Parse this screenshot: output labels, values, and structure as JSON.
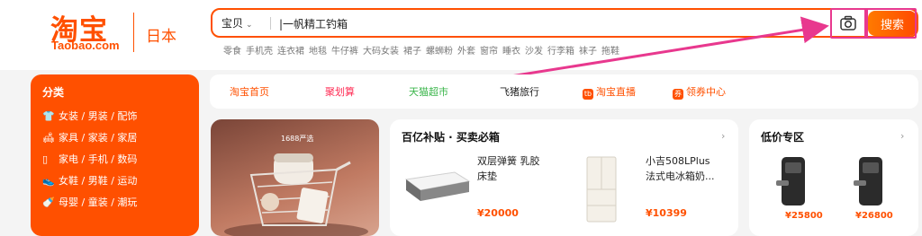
{
  "logo": {
    "name_cn": "淘宝",
    "name_en": "Taobao.com",
    "region": "日本"
  },
  "search": {
    "scope": "宝贝",
    "query": "|一帆精工钓箱",
    "button": "搜索",
    "hot_words": [
      "零食",
      "手机壳",
      "连衣裙",
      "地毯",
      "牛仔裤",
      "大码女装",
      "裙子",
      "螺蛳粉",
      "外套",
      "窗帘",
      "睡衣",
      "沙发",
      "行李箱",
      "袜子",
      "拖鞋"
    ]
  },
  "category": {
    "title": "分类",
    "rows": [
      {
        "icon": "shirt-icon",
        "text": "女装 / 男装 / 配饰"
      },
      {
        "icon": "sofa-icon",
        "text": "家具 / 家装 / 家居"
      },
      {
        "icon": "phone-icon",
        "text": "家电 / 手机 / 数码"
      },
      {
        "icon": "shoe-icon",
        "text": "女鞋 / 男鞋 / 运动"
      },
      {
        "icon": "baby-icon",
        "text": "母婴 / 童装 / 潮玩"
      }
    ]
  },
  "nav": [
    {
      "label": "淘宝首页",
      "color": "#ff5000"
    },
    {
      "label": "聚划算",
      "color": "#ff2d55"
    },
    {
      "label": "天猫超市",
      "color": "#3ab54a"
    },
    {
      "label": "飞猪旅行",
      "color": "#222222"
    },
    {
      "label": "淘宝直播",
      "color": "#ff5000"
    },
    {
      "label": "领券中心",
      "color": "#ff5000"
    }
  ],
  "banner": {
    "tag": "1688严选"
  },
  "subsidy": {
    "title": "百亿补贴 · 买卖必箱",
    "more": "›",
    "products": [
      {
        "name_line1": "双层弹簧 乳胶",
        "name_line2": "床垫",
        "price": "¥20000"
      },
      {
        "name_line1": "小吉508LPlus",
        "name_line2": "法式电冰箱奶...",
        "price": "¥10399"
      }
    ]
  },
  "lowprice": {
    "title": "低价专区",
    "more": "›",
    "prices": [
      "¥25800",
      "¥26800"
    ]
  },
  "colors": {
    "brand": "#ff5000",
    "highlight": "#e8388e"
  }
}
